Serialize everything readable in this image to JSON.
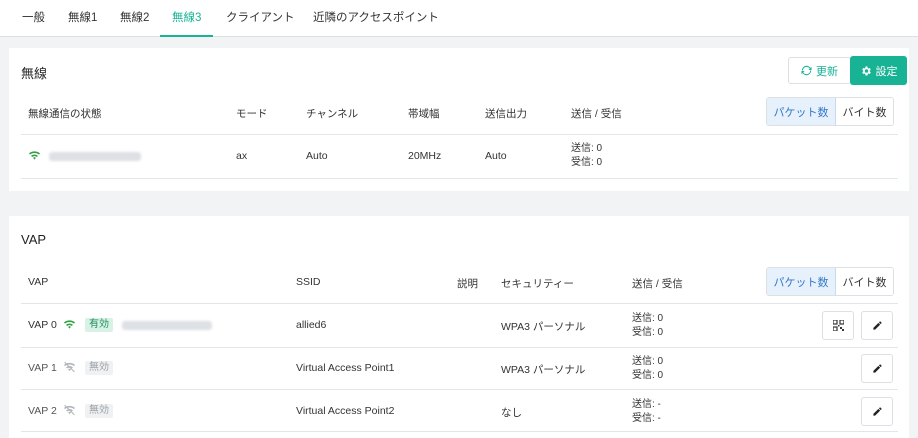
{
  "tabs": [
    "一般",
    "無線1",
    "無線2",
    "無線3",
    "クライアント",
    "近隣のアクセスポイント"
  ],
  "colors": {
    "accent": "#18b394",
    "toggle_selected": "#3478c9"
  },
  "wireless": {
    "title": "無線",
    "refresh_label": "更新",
    "settings_label": "設定",
    "toggle": {
      "packets": "パケット数",
      "bytes": "バイト数"
    },
    "headers": {
      "status": "無線通信の状態",
      "mode": "モード",
      "channel": "チャンネル",
      "bandwidth": "帯域幅",
      "tx_power": "送信出力",
      "txrx": "送信 / 受信"
    },
    "row": {
      "mode": "ax",
      "channel": "Auto",
      "bandwidth": "20MHz",
      "tx_power": "Auto",
      "tx": "送信: 0",
      "rx": "受信: 0",
      "icon": "wifi-icon"
    }
  },
  "vap": {
    "title": "VAP",
    "toggle": {
      "packets": "パケット数",
      "bytes": "バイト数"
    },
    "headers": {
      "vap": "VAP",
      "ssid": "SSID",
      "desc": "説明",
      "security": "セキュリティー",
      "txrx": "送信 / 受信"
    },
    "rows": [
      {
        "name": "VAP 0",
        "status": "有効",
        "ssid": "allied6",
        "security": "WPA3 パーソナル",
        "tx": "送信: 0",
        "rx": "受信: 0"
      },
      {
        "name": "VAP 1",
        "status": "無効",
        "ssid": "Virtual Access Point1",
        "security": "WPA3 パーソナル",
        "tx": "送信: 0",
        "rx": "受信: 0"
      },
      {
        "name": "VAP 2",
        "status": "無効",
        "ssid": "Virtual Access Point2",
        "security": "なし",
        "tx": "送信: -",
        "rx": "受信: -"
      }
    ]
  }
}
